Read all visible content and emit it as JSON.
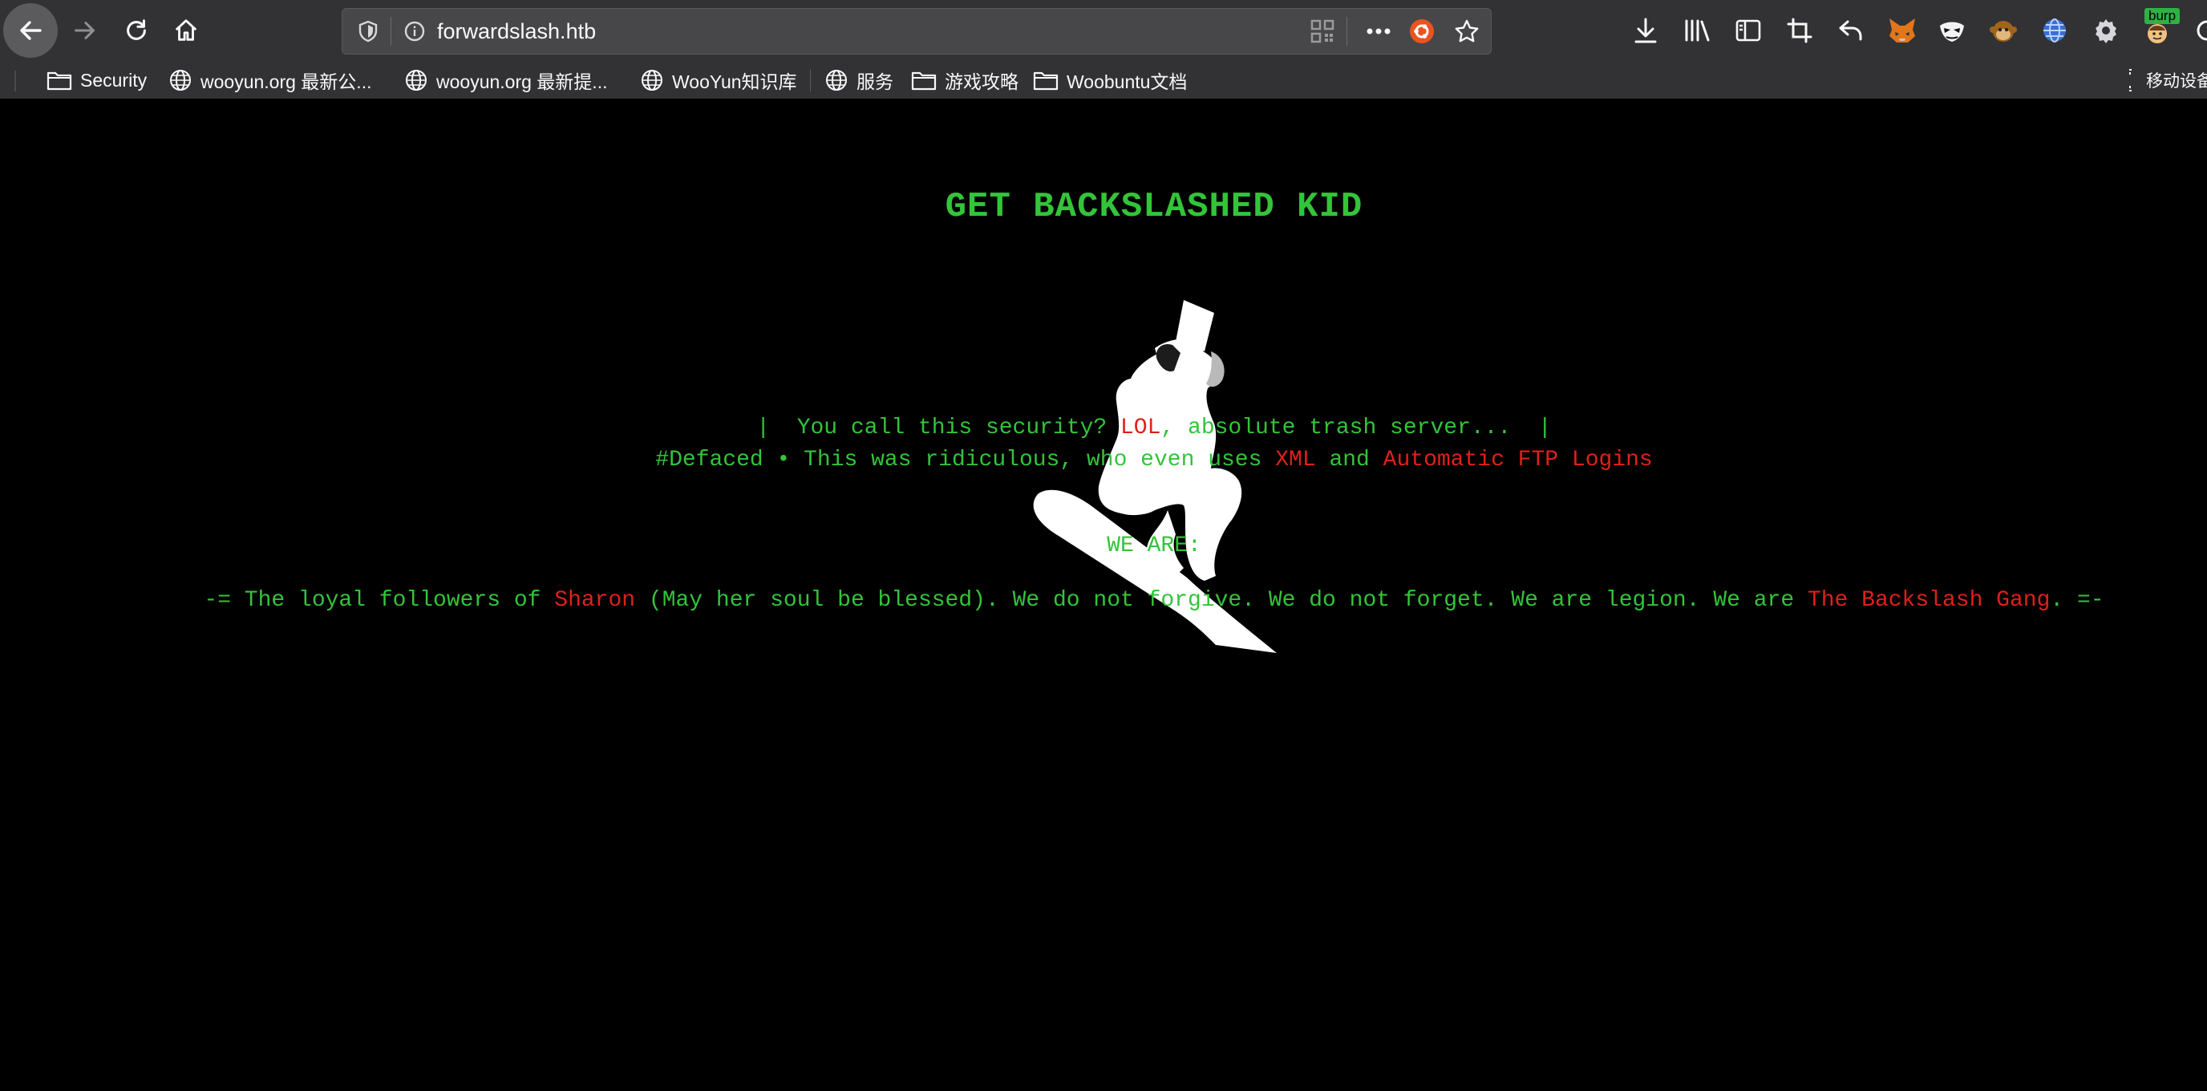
{
  "browser": {
    "url": "forwardslash.htb",
    "icons": {
      "back": "back-arrow-icon",
      "forward": "forward-arrow-icon",
      "reload": "reload-icon",
      "home": "home-icon",
      "tracking": "shield-icon",
      "info": "info-icon",
      "qr": "qr-code-icon",
      "more": "more-dots-icon",
      "ubuntu": "ubuntu-icon",
      "star": "star-icon"
    },
    "extensions": {
      "burp_badge": "burp"
    }
  },
  "bookmarks": [
    {
      "label": "Security",
      "icon": "folder-icon"
    },
    {
      "label": "wooyun.org 最新公...",
      "icon": "globe-icon"
    },
    {
      "label": "wooyun.org 最新提...",
      "icon": "globe-icon"
    },
    {
      "label": "WooYun知识库",
      "icon": "globe-icon"
    },
    {
      "label": "服务",
      "icon": "globe-icon"
    },
    {
      "label": "游戏攻略",
      "icon": "folder-icon"
    },
    {
      "label": "Woobuntu文档",
      "icon": "folder-icon"
    }
  ],
  "other_bookmarks": "移动设备",
  "page": {
    "headline": "GET BACKSLASHED KID",
    "line1": {
      "a": "|  You call this security? ",
      "b": "LOL",
      "c": ", absolute trash server...  |"
    },
    "line2": {
      "a": "#Defaced • This was ridiculous, who even uses ",
      "b": "XML",
      "c": " and ",
      "d": "Automatic FTP Logins"
    },
    "we_are": "WE ARE:",
    "line3": {
      "a": "-= The loyal followers of ",
      "b": "Sharon",
      "c": " (May her soul be blessed). We do not forgive. We do not forget. We are legion. We are ",
      "d": "The Backslash Gang",
      "e": ". =-"
    },
    "colors": {
      "background": "#000000",
      "green": "#33c43a",
      "red": "#e0201a"
    },
    "image": "snowboarder-silhouette"
  }
}
